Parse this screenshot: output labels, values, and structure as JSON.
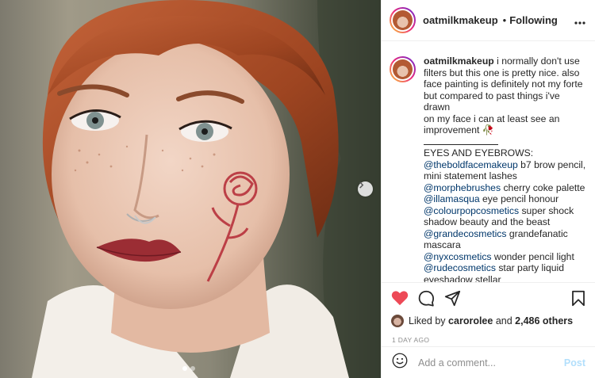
{
  "header": {
    "username": "oatmilkmakeup",
    "separator": "•",
    "follow_status": "Following",
    "more_icon": "more-horizontal-icon"
  },
  "caption": {
    "username": "oatmilkmakeup",
    "lines": [
      " i normally don't use",
      "filters but this one is pretty nice. also",
      "face painting is definitely not my forte",
      "but compared to past things i've drawn",
      "on my face i can at least see an",
      "improvement 🥀"
    ],
    "section_title": "EYES AND EYEBROWS:",
    "products": [
      {
        "mention": "@theboldfacemakeup",
        "text": " b7 brow pencil,"
      },
      {
        "mention": "",
        "text": "mini statement lashes"
      },
      {
        "mention": "@morphebrushes",
        "text": " cherry coke palette"
      },
      {
        "mention": "@illamasqua",
        "text": " eye pencil honour"
      },
      {
        "mention": "@colourpopcosmetics",
        "text": " super shock"
      },
      {
        "mention": "",
        "text": "shadow beauty and the beast"
      },
      {
        "mention": "@grandecosmetics",
        "text": " grandefanatic"
      },
      {
        "mention": "",
        "text": "mascara"
      },
      {
        "mention": "@nyxcosmetics",
        "text": " wonder pencil light"
      },
      {
        "mention": "@rudecosmetics",
        "text": " star party liquid"
      },
      {
        "mention": "",
        "text": "eyeshadow stellar"
      }
    ]
  },
  "actions": {
    "like_icon": "heart-filled-icon",
    "comment_icon": "comment-icon",
    "share_icon": "share-icon",
    "save_icon": "bookmark-icon",
    "like_color": "#ed4956"
  },
  "likes": {
    "prefix": "Liked by ",
    "user": "carorolee",
    "middle": " and ",
    "others": "2,486 others"
  },
  "timestamp": "1 DAY AGO",
  "comment": {
    "placeholder": "Add a comment...",
    "post_label": "Post",
    "emoji_icon": "smiley-icon"
  },
  "carousel": {
    "current": 1,
    "total": 2,
    "next_icon": "chevron-right-icon"
  }
}
